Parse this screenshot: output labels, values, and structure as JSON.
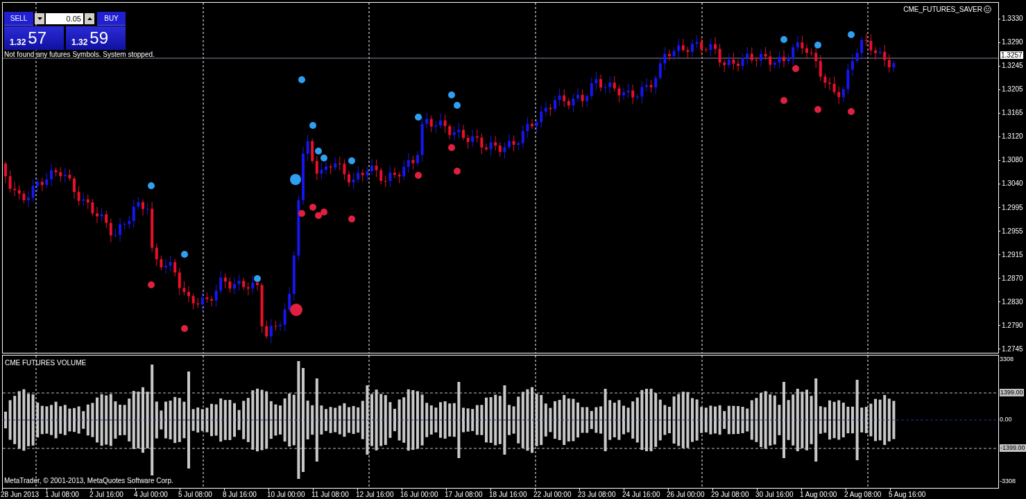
{
  "trade_panel": {
    "sell": {
      "label": "SELL",
      "price_big": "1.32",
      "price_pips": "57"
    },
    "lot": "0.05",
    "buy": {
      "label": "BUY",
      "price_big": "1.32",
      "price_pips": "59"
    }
  },
  "message": "Not found any futures Symbols. System stopped.",
  "expert_name": "CME_FUTURES_SAVER",
  "current_price": "1.3257",
  "price_axis": [
    "1.3330",
    "1.3290",
    "1.3245",
    "1.3205",
    "1.3165",
    "1.3120",
    "1.3080",
    "1.3040",
    "1.2995",
    "1.2955",
    "1.2915",
    "1.2870",
    "1.2830",
    "1.2790",
    "1.2745"
  ],
  "indicator": {
    "title": "CME FUTURES VOLUME",
    "copyright": "MetaTrader, © 2001-2013, MetaQuotes Software Corp.",
    "axis": [
      {
        "label": "3308",
        "kind": "plain"
      },
      {
        "label": "1399.00",
        "kind": "level"
      },
      {
        "label": "0.00",
        "kind": "zero"
      },
      {
        "label": "-1399.00",
        "kind": "level"
      },
      {
        "label": "-3308",
        "kind": "plain"
      }
    ]
  },
  "time_axis": [
    "28 Jun 2013",
    "1 Jul 08:00",
    "2 Jul 16:00",
    "4 Jul 00:00",
    "5 Jul 08:00",
    "8 Jul 16:00",
    "10 Jul 00:00",
    "11 Jul 08:00",
    "12 Jul 16:00",
    "16 Jul 00:00",
    "17 Jul 08:00",
    "18 Jul 16:00",
    "22 Jul 00:00",
    "23 Jul 08:00",
    "24 Jul 16:00",
    "26 Jul 00:00",
    "29 Jul 08:00",
    "30 Jul 16:00",
    "1 Aug 00:00",
    "2 Aug 08:00",
    "5 Aug 16:00"
  ]
}
